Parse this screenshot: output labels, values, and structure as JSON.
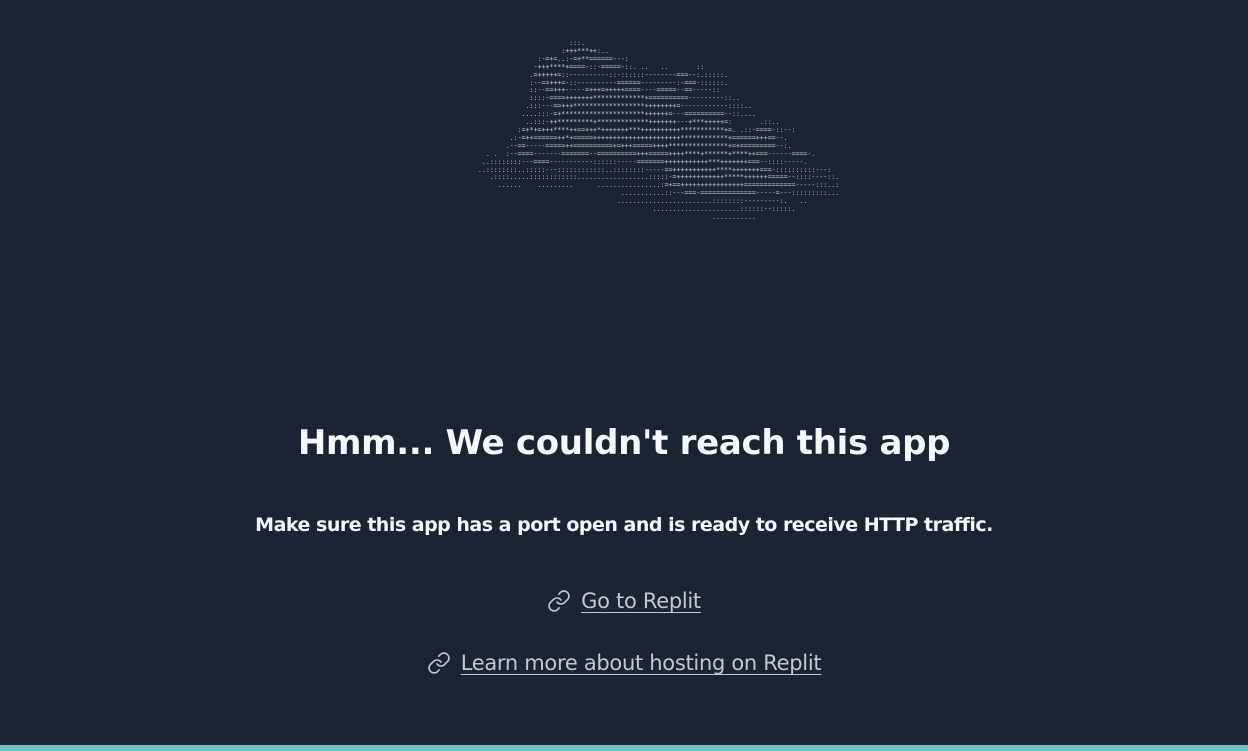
{
  "ascii_art": {
    "lines": [
      "                          :::.",
      "                        :+++***++:..",
      "                  :-=+=..:-=+**======---:",
      "                 -+++****+====-::-=====-::. ..   ..       ::",
      "                .=+++++=::----------::-::::::--------===--:.:::::.",
      "                :--==+++=-::----------======---------:-===-::::::.",
      "                ::--==+++-----=+++=+++++====----=====--==-----::",
      "                ::::-====+++++++*************+==========---------::..",
      "               .:::---==+++******************++++++++=------------::::..",
      "              ....:::-=+*********************++++++=---==========--::....",
      "               ..:::-++*********+*************+++++++---+***+++++=:       .::..",
      "             :=+*+=+++****++==+++*+++++++***++++++++++***********+=. .::-====-::--:",
      "           .:-=++======++*+=====++++++++++++++++++++++************+======+++==--.",
      "          .--==-----=====++==========+=+++=====++++***************+=+=========--:.",
      "     . .  :--====-------=======--==========+++=====++++****+******+****++===------====-.",
      "    ..::::::::---====-----------::::::-----=======+++++++++++***+++++++===--::::-----.",
      "   ..::::::::..:::::---::::::::::::..::::::::-----==+++++++++++****+++++++===-::::::::::---:",
      "      .::::.....::::::::::::..................:::::-=++++++++++++*****++++++=====--::::----::.",
      "        ......    .........      ................:=+==++++++++++++++++=============-----:::..:",
      "                                       ...........::---===-==============-----=---:::::::::...",
      "                                      ........................::::::::---------:.   ..",
      "                                               ......................::::::--:::::.",
      "                                                              ..........."
    ]
  },
  "title": "Hmm... We couldn't reach this app",
  "subtitle": "Make sure this app has a port open and is ready to receive HTTP traffic.",
  "links": [
    {
      "label": "Go to Replit",
      "icon": "link-icon"
    },
    {
      "label": "Learn more about hosting on Replit",
      "icon": "link-icon"
    }
  ],
  "colors": {
    "background": "#1c2333",
    "text": "#f5f9fc",
    "link": "#c2c8cc",
    "accent_bar": "#5fc6c0"
  }
}
